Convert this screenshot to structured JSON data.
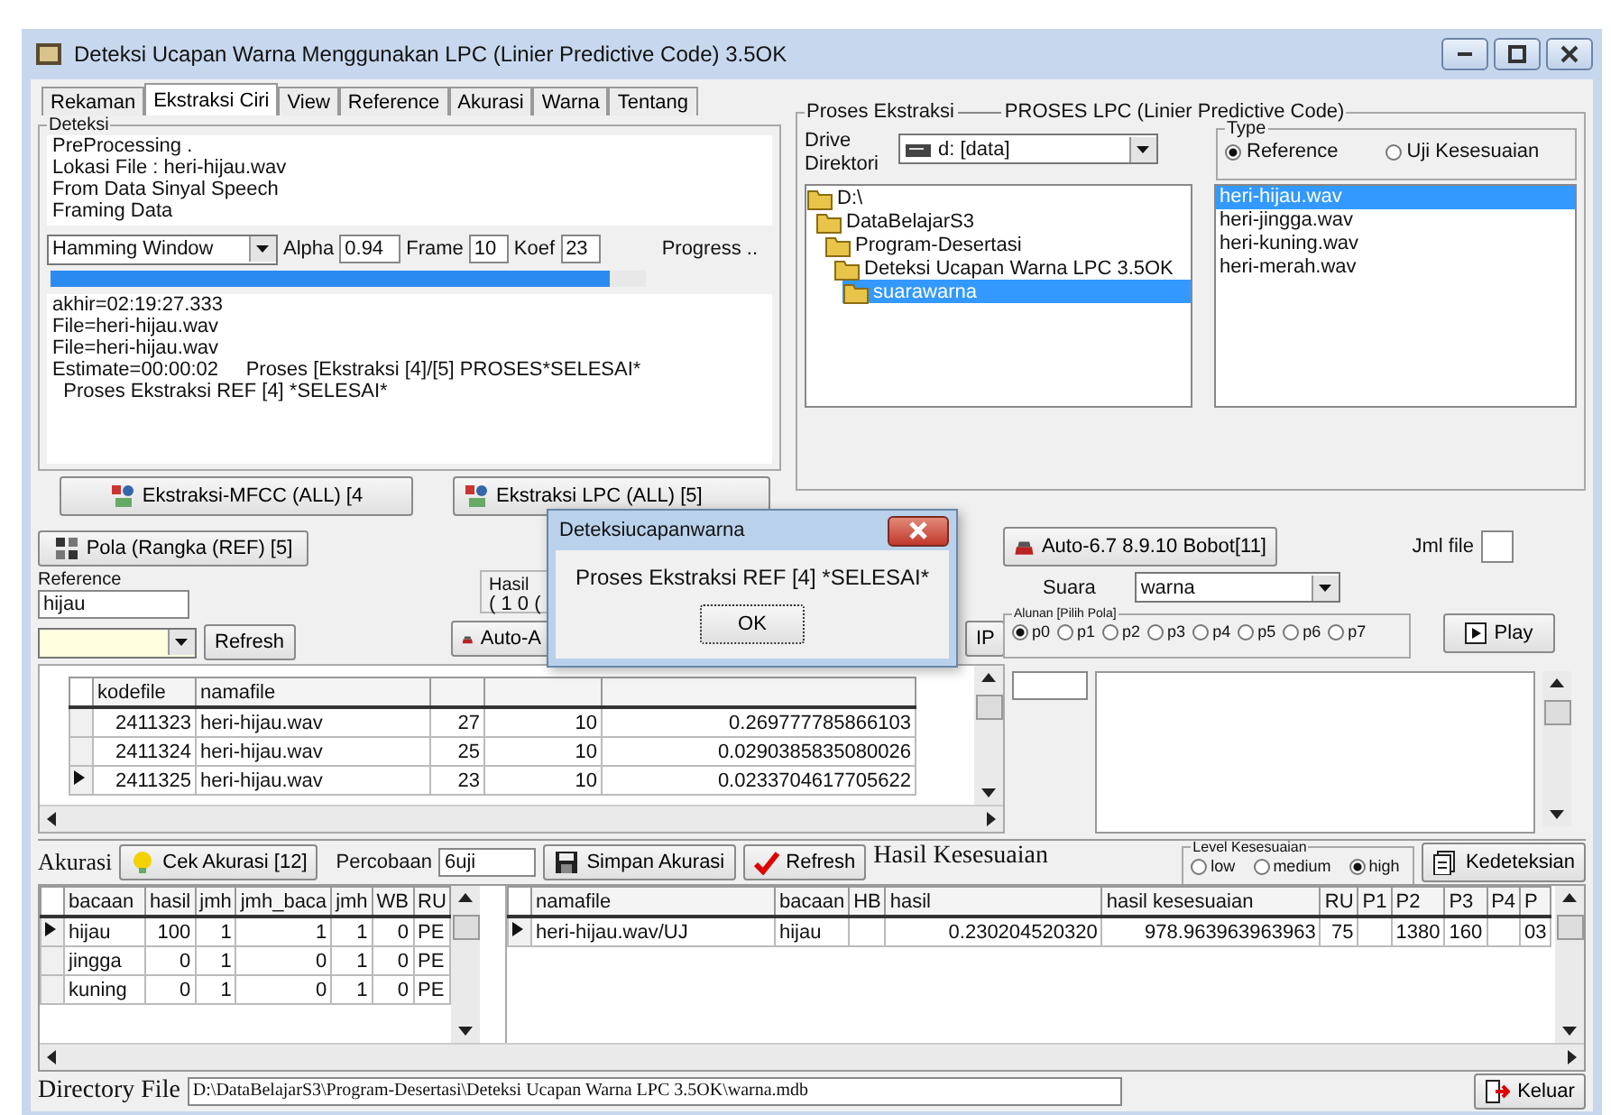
{
  "window": {
    "title": "Deteksi Ucapan Warna Menggunakan LPC (Linier Predictive Code) 3.5OK"
  },
  "tabs": [
    {
      "label": "Rekaman",
      "selected": false
    },
    {
      "label": "Ekstraksi Ciri",
      "selected": true
    },
    {
      "label": "View",
      "selected": false
    },
    {
      "label": "Reference",
      "selected": false
    },
    {
      "label": "Akurasi",
      "selected": false
    },
    {
      "label": "Warna",
      "selected": false
    },
    {
      "label": "Tentang",
      "selected": false
    }
  ],
  "deteksi": {
    "title": "Deteksi",
    "info_lines": [
      "PreProcessing .",
      "Lokasi File : heri-hijau.wav",
      "From Data Sinyal Speech",
      "Framing Data"
    ],
    "window_type": "Hamming Window",
    "alpha_label": "Alpha",
    "alpha": "0.94",
    "frame_label": "Frame",
    "frame": "10",
    "koef_label": "Koef",
    "koef": "23",
    "progress_label": "Progress ..",
    "progress": {
      "level": 0.94
    },
    "log_lines": [
      "akhir=02:19:27.333",
      "File=heri-hijau.wav",
      "File=heri-hijau.wav",
      "Estimate=00:00:02     Proses [Ekstraksi [4]/[5] PROSES*SELESAI*",
      "  Proses Ekstraksi REF [4] *SELESAI*"
    ],
    "buttons": [
      "Ekstraksi-MFCC (ALL) [4",
      "Ekstraksi LPC (ALL) [5]"
    ]
  },
  "proses_lpc": {
    "title": "Proses Ekstraksi",
    "subtitle": "PROSES LPC (Linier Predictive Code)",
    "drive_label": "Drive",
    "directory_label": "Direktori",
    "drive": "d: [data]",
    "type": {
      "title": "Type",
      "options": [
        {
          "label": "Reference",
          "selected": true
        },
        {
          "label": "Uji Kesesuaian",
          "selected": false
        }
      ]
    },
    "folders": [
      {
        "name": "D:\\",
        "selected": false,
        "children": [
          {
            "name": "DataBelajarS3",
            "selected": false,
            "children": [
              {
                "name": "Program-Desertasi",
                "selected": false,
                "children": [
                  {
                    "name": "Deteksi Ucapan Warna LPC 3.5OK",
                    "selected": false,
                    "children": [
                      {
                        "name": "suarawarna",
                        "selected": true
                      }
                    ]
                  }
                ]
              }
            ]
          }
        ]
      }
    ],
    "files": [
      {
        "name": "heri-hijau.wav",
        "selected": true
      },
      {
        "name": "heri-jingga.wav",
        "selected": false
      },
      {
        "name": "heri-kuning.wav",
        "selected": false
      },
      {
        "name": "heri-merah.wav",
        "selected": false
      }
    ]
  },
  "reference": {
    "pola_button": "Pola (Rangka (REF) [5]",
    "reference_label": "Reference",
    "reference": "hijau",
    "refresh_button": "Refresh",
    "hasil_label": "Hasil",
    "hasil_partial": "( 1 0 (",
    "auto_button": "Auto-A",
    "ip_button": "IP",
    "bobot_button": "Auto-6.7 8.9.10 Bobot[11]",
    "jml_label": "Jml file",
    "suara_label": "Suara",
    "suara": "warna",
    "alunan": {
      "title": "Alunan [Pilih Pola]",
      "options": [
        {
          "label": "p0",
          "selected": true
        },
        {
          "label": "p1",
          "selected": false
        },
        {
          "label": "p2",
          "selected": false
        },
        {
          "label": "p3",
          "selected": false
        },
        {
          "label": "p4",
          "selected": false
        },
        {
          "label": "p5",
          "selected": false
        },
        {
          "label": "p6",
          "selected": false
        },
        {
          "label": "p7",
          "selected": false
        }
      ]
    },
    "play_button": "Play",
    "table": {
      "columns": [
        "kodefile",
        "namafile"
      ],
      "rows": [
        {
          "cells": [
            "2411323",
            "heri-hijau.wav",
            "27",
            "10",
            "0.269777785866103"
          ],
          "selected": false
        },
        {
          "cells": [
            "2411324",
            "heri-hijau.wav",
            "25",
            "10",
            "0.0290385835080026"
          ],
          "selected": false
        },
        {
          "cells": [
            "2411325",
            "heri-hijau.wav",
            "23",
            "10",
            "0.0233704617705622"
          ],
          "selected": true
        }
      ]
    }
  },
  "akurasi": {
    "label": "Akurasi",
    "cek_button": "Cek Akurasi [12]",
    "percobaan_label": "Percobaan",
    "percobaan": "6uji",
    "simpan_button": "Simpan Akurasi",
    "refresh_button": "Refresh",
    "hasil_label": "Hasil Kesesuaian",
    "level": {
      "title": "Level Kesesuaian",
      "options": [
        {
          "label": "low",
          "selected": false
        },
        {
          "label": "medium",
          "selected": false
        },
        {
          "label": "high",
          "selected": true
        }
      ]
    },
    "deteksi_button": "Kedeteksian",
    "table": {
      "columns": [
        "bacaan",
        "hasil",
        "jmh",
        "jmh_baca",
        "jmh",
        "WB",
        "RU"
      ],
      "rows": [
        {
          "cells": [
            "hijau",
            "100",
            "1",
            "1",
            "1",
            "0",
            "PE"
          ],
          "selected": true
        },
        {
          "cells": [
            "jingga",
            "0",
            "1",
            "0",
            "1",
            "0",
            "PE"
          ],
          "selected": false
        },
        {
          "cells": [
            "kuning",
            "0",
            "1",
            "0",
            "1",
            "0",
            "PE"
          ],
          "selected": false
        }
      ]
    },
    "hasil_table": {
      "columns": [
        "namafile",
        "bacaan",
        "HB",
        "hasil",
        "hasil kesesuaian",
        "RU",
        "P1",
        "P2",
        "P3",
        "P4",
        "P"
      ],
      "rows": [
        {
          "cells": [
            "heri-hijau.wav/UJ",
            "hijau",
            null,
            "0.230204520320",
            "978.963963963963",
            "75",
            null,
            "1380",
            "160",
            null,
            "03"
          ],
          "selected": true
        }
      ]
    }
  },
  "status_bar": {
    "label": "Directory File",
    "path": "D:\\DataBelajarS3\\Program-Desertasi\\Deteksi Ucapan Warna LPC 3.5OK\\warna.mdb",
    "keluar_button": "Keluar"
  },
  "dialog": {
    "title": "Deteksiucapanwarna",
    "message": "Proses Ekstraksi REF [4] *SELESAI*",
    "button": "OK"
  }
}
